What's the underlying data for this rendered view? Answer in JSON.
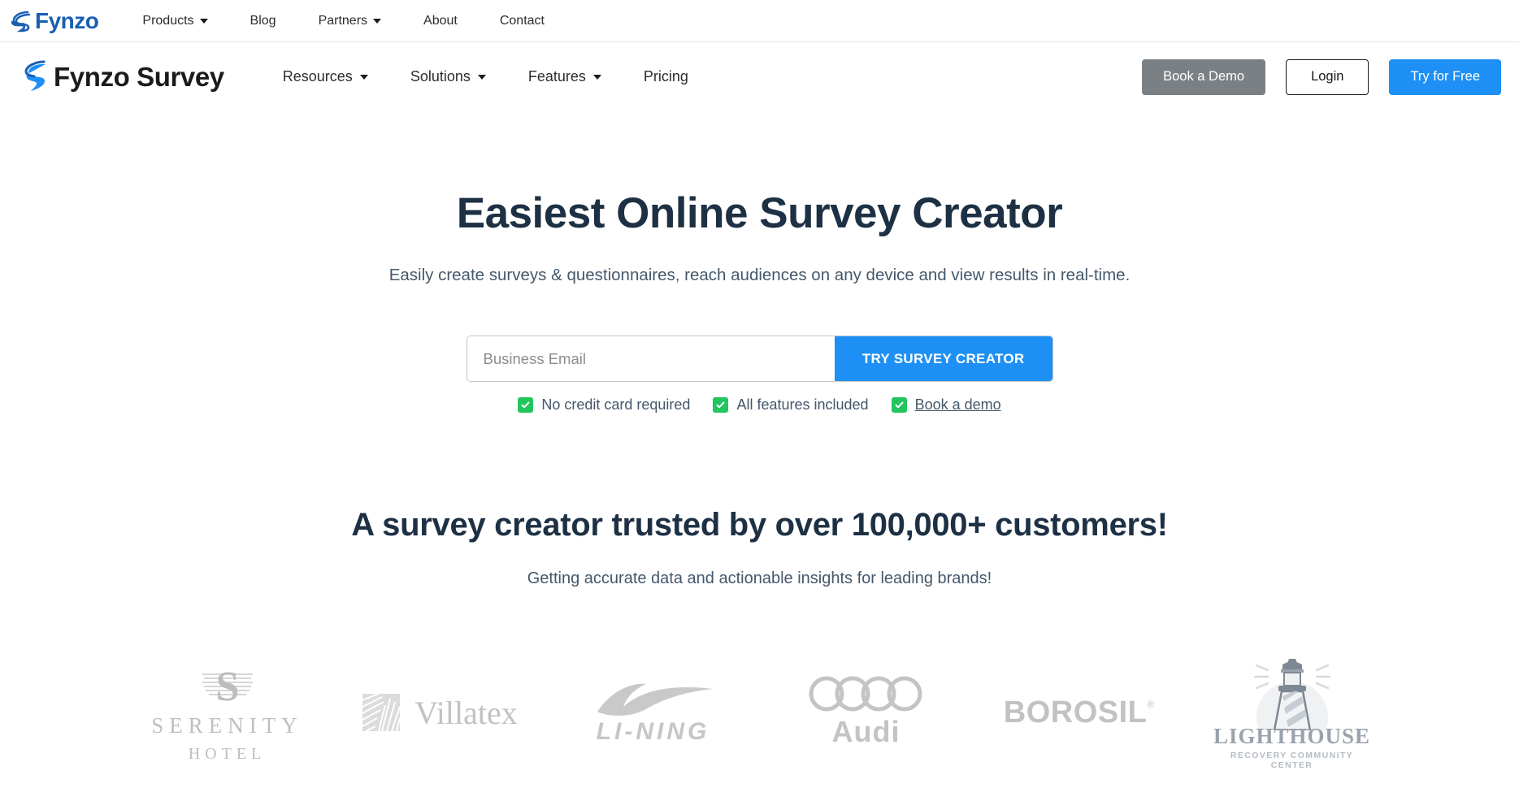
{
  "topbar": {
    "brand": "Fynzo",
    "brand_color": "#1a5fb4",
    "nav": [
      {
        "label": "Products",
        "has_caret": true
      },
      {
        "label": "Blog",
        "has_caret": false
      },
      {
        "label": "Partners",
        "has_caret": true
      },
      {
        "label": "About",
        "has_caret": false
      },
      {
        "label": "Contact",
        "has_caret": false
      }
    ]
  },
  "header": {
    "brand": "Fynzo Survey",
    "nav": [
      {
        "label": "Resources",
        "has_caret": true
      },
      {
        "label": "Solutions",
        "has_caret": true
      },
      {
        "label": "Features",
        "has_caret": true
      },
      {
        "label": "Pricing",
        "has_caret": false
      }
    ],
    "actions": {
      "demo": "Book a Demo",
      "login": "Login",
      "try": "Try for Free"
    },
    "colors": {
      "demo_bg": "#7b8085",
      "try_bg": "#1e90f5"
    }
  },
  "hero": {
    "title": "Easiest Online Survey Creator",
    "subtitle": "Easily create surveys & questionnaires, reach audiences on any device and view results in real-time.",
    "email_placeholder": "Business Email",
    "email_value": "",
    "cta_label": "TRY SURVEY CREATOR",
    "features": [
      {
        "label": "No credit card required",
        "is_link": false
      },
      {
        "label": "All features included",
        "is_link": false
      },
      {
        "label": "Book a demo",
        "is_link": true
      }
    ],
    "check_color": "#22c55e"
  },
  "trusted": {
    "title": "A survey creator trusted by over 100,000+ customers!",
    "subtitle": "Getting accurate data and actionable insights for leading brands!",
    "logos": [
      {
        "name": "Serenity Hotel",
        "word": "SERENITY",
        "sub": "HOTEL"
      },
      {
        "name": "Villatex",
        "word": "Villatex",
        "sub": ""
      },
      {
        "name": "Li-Ning",
        "word": "LI-NING",
        "sub": ""
      },
      {
        "name": "Audi",
        "word": "Audi",
        "sub": ""
      },
      {
        "name": "Borosil",
        "word": "BOROSIL",
        "sub": "®"
      },
      {
        "name": "Lighthouse Recovery Community Center",
        "word": "LIGHTHOUSE",
        "sub": "RECOVERY COMMUNITY CENTER"
      }
    ]
  }
}
